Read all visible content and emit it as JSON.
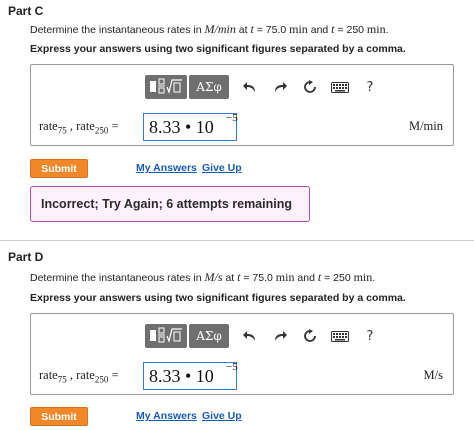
{
  "partC": {
    "title": "Part C",
    "question": {
      "prefix": "Determine the instantaneous rates in ",
      "unit": "M/min",
      "mid1": " at ",
      "t1var": "t",
      "mid2": " = 75.0 ",
      "t1unit": "min",
      "mid3": " and ",
      "t2var": "t",
      "mid4": " = 250 ",
      "t2unit": "min",
      "suffix": "."
    },
    "instruction": "Express your answers using two significant figures separated by a comma.",
    "toolbar": {
      "templates_icon": "template-sqrt-icon",
      "greek": "ΑΣφ",
      "undo_icon": "undo-icon",
      "redo_icon": "redo-icon",
      "reset_icon": "reset-icon",
      "keyboard_icon": "keyboard-icon",
      "help": "?"
    },
    "label": {
      "rate": "rate",
      "sub1": "75",
      "sep": " , rate",
      "sub2": "250",
      "eq": " ="
    },
    "answer": {
      "value": "8.33 • 10",
      "exponent": "−5"
    },
    "unit": "M/min",
    "submit": "Submit",
    "my_answers": "My Answers",
    "give_up": "Give Up",
    "feedback": "Incorrect; Try Again; 6 attempts remaining"
  },
  "partD": {
    "title": "Part D",
    "question": {
      "prefix": "Determine the instantaneous rates in ",
      "unit": "M/s",
      "mid1": " at ",
      "t1var": "t",
      "mid2": " = 75.0 ",
      "t1unit": "min",
      "mid3": " and ",
      "t2var": "t",
      "mid4": " = 250 ",
      "t2unit": "min",
      "suffix": "."
    },
    "instruction": "Express your answers using two significant figures separated by a comma.",
    "toolbar": {
      "templates_icon": "template-sqrt-icon",
      "greek": "ΑΣφ",
      "undo_icon": "undo-icon",
      "redo_icon": "redo-icon",
      "reset_icon": "reset-icon",
      "keyboard_icon": "keyboard-icon",
      "help": "?"
    },
    "label": {
      "rate": "rate",
      "sub1": "75",
      "sep": " , rate",
      "sub2": "250",
      "eq": " ="
    },
    "answer": {
      "value": "8.33 • 10",
      "exponent": "−5"
    },
    "unit": "M/s",
    "submit": "Submit",
    "my_answers": "My Answers",
    "give_up": "Give Up"
  },
  "colors": {
    "submit": "#f0882a",
    "link": "#1a5bb8",
    "feedback_border": "#b04cb0",
    "toolbar_button": "#6f6f6f",
    "input_border": "#3a7bd5"
  }
}
